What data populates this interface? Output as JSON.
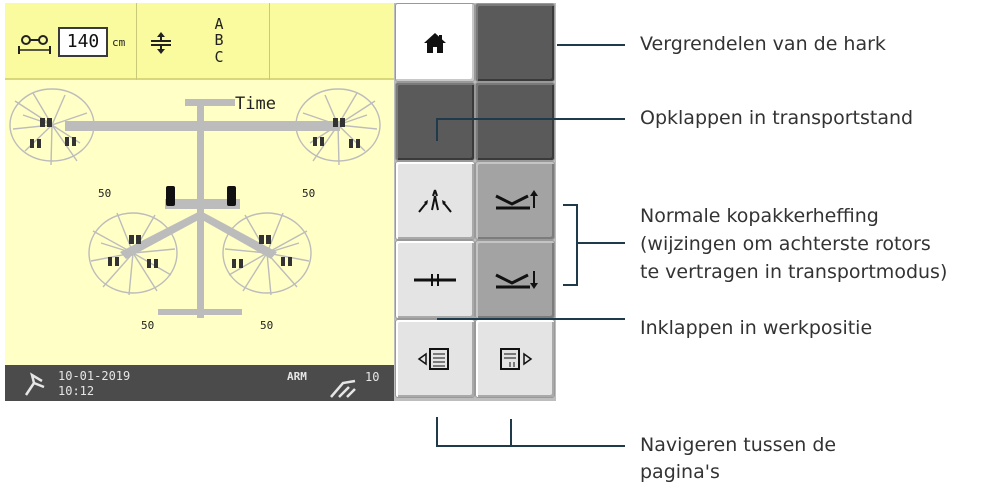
{
  "screen": {
    "width": {
      "value": "140",
      "unit": "cm",
      "icon": "working-width-icon"
    },
    "rotor_order": {
      "icon": "adjust-arrows-icon",
      "letters": [
        "A",
        "B",
        "C"
      ]
    },
    "work_label": "Time",
    "rotor_values": {
      "front_left": "50",
      "front_right": "50",
      "rear_left": "50",
      "rear_right": "50"
    }
  },
  "status": {
    "date": "10-01-2019",
    "time": "10:12",
    "arm_label": "ARM",
    "arm_value": "10",
    "left_icon": "rake-status-icon",
    "right_icon": "arm-icon"
  },
  "softkeys": [
    {
      "name": "home-key",
      "icon": "home-icon"
    },
    {
      "name": "blank-key-1",
      "icon": ""
    },
    {
      "name": "blank-key-2",
      "icon": ""
    },
    {
      "name": "blank-key-3",
      "icon": ""
    },
    {
      "name": "fold-in-key",
      "icon": "fold-in-icon"
    },
    {
      "name": "headland-up-key",
      "icon": "headland-raise-icon"
    },
    {
      "name": "unfold-key",
      "icon": "unfold-icon"
    },
    {
      "name": "headland-down-key",
      "icon": "headland-lower-icon"
    },
    {
      "name": "page-prev-key",
      "icon": "page-prev-icon"
    },
    {
      "name": "page-next-key",
      "icon": "page-next-icon"
    }
  ],
  "annotations": [
    "Vergrendelen van de hark",
    "Opklappen in transportstand",
    "Normale kopakkerheffing",
    "(wijzingen om achterste rotors",
    "te vertragen in transportmodus)",
    "Inklappen in werkpositie",
    "Navigeren tussen de",
    "pagina's"
  ],
  "colors": {
    "screen_bg": "#ffffc6",
    "topbar_bg": "#fafa9e",
    "status_bg": "#4b4b4b",
    "line_color": "#1f3a4a",
    "rake_gray": "#bcbcbc"
  }
}
